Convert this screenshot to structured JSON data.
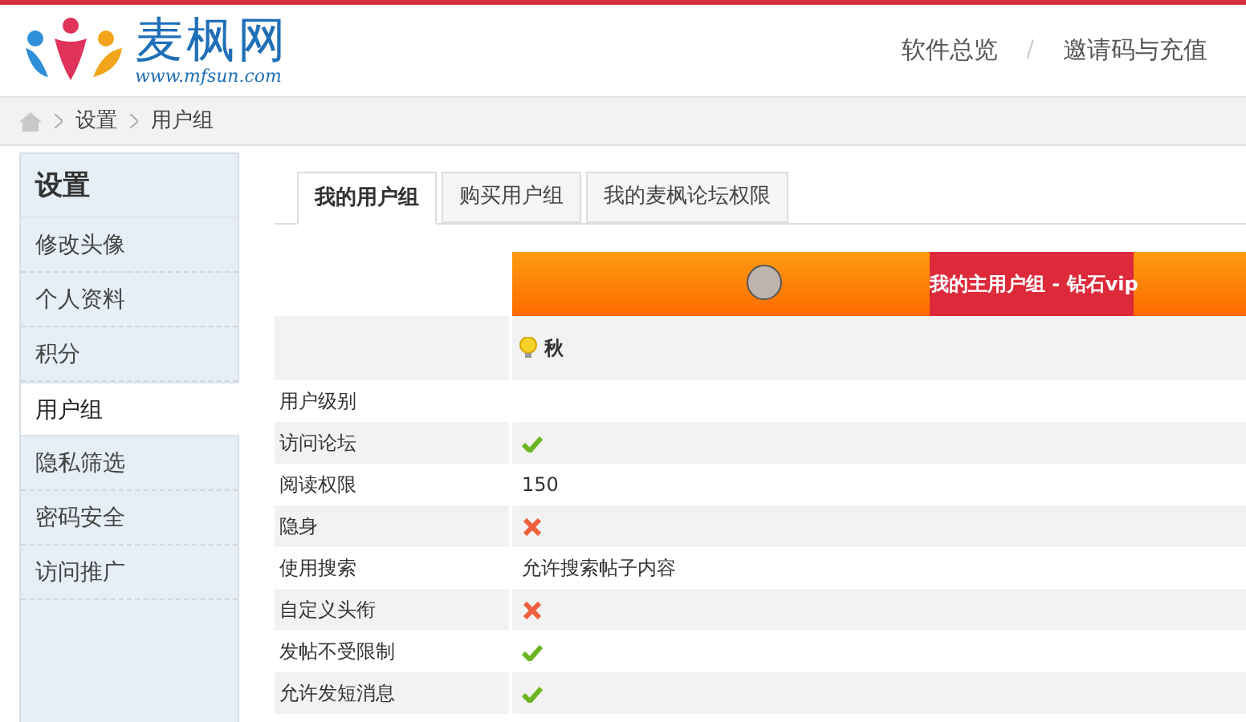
{
  "header": {
    "logo_text": "麦枫网",
    "logo_url": "www.mfsun.com",
    "nav": [
      {
        "label": "软件总览"
      },
      {
        "label": "邀请码与充值"
      }
    ],
    "separator": "/"
  },
  "breadcrumb": [
    "设置",
    "用户组"
  ],
  "sidebar": {
    "title": "设置",
    "items": [
      {
        "label": "修改头像",
        "selected": false
      },
      {
        "label": "个人资料",
        "selected": false
      },
      {
        "label": "积分",
        "selected": false
      },
      {
        "label": "用户组",
        "selected": true
      },
      {
        "label": "隐私筛选",
        "selected": false
      },
      {
        "label": "密码安全",
        "selected": false
      },
      {
        "label": "访问推广",
        "selected": false
      }
    ]
  },
  "tabs": [
    {
      "label": "我的用户组",
      "selected": true
    },
    {
      "label": "购买用户组",
      "selected": false
    },
    {
      "label": "我的麦枫论坛权限",
      "selected": false
    }
  ],
  "group_header": {
    "title": "我的主用户组 - 钻石vip",
    "member": "秋"
  },
  "rows": [
    {
      "label": "用户级别",
      "kind": "text"
    },
    {
      "label": "访问论坛",
      "kind": "mark",
      "allowed": true
    },
    {
      "label": "阅读权限",
      "kind": "text",
      "value": "150"
    },
    {
      "label": "隐身",
      "kind": "mark",
      "allowed": false
    },
    {
      "label": "使用搜索",
      "kind": "text",
      "value": "允许搜索帖子内容"
    },
    {
      "label": "自定义头衔",
      "kind": "mark",
      "allowed": false
    },
    {
      "label": "发帖不受限制",
      "kind": "mark",
      "allowed": true
    },
    {
      "label": "允许发短消息",
      "kind": "mark",
      "allowed": true
    }
  ]
}
